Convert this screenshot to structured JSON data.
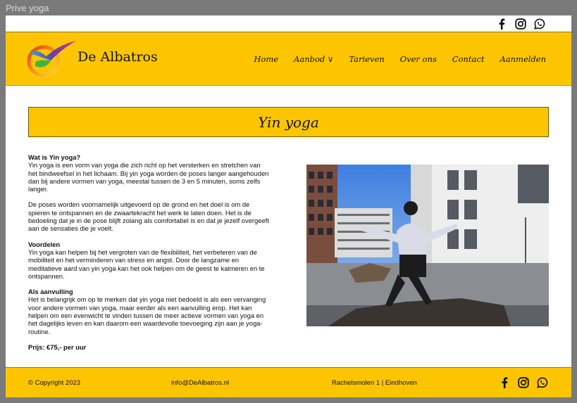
{
  "window": {
    "title": "Prive yoga"
  },
  "social": {
    "icons": [
      "facebook-icon",
      "instagram-icon",
      "whatsapp-icon"
    ]
  },
  "header": {
    "brand": "De Albatros",
    "nav": [
      "Home",
      "Aanbod ∨",
      "Tarieven",
      "Over ons",
      "Contact",
      "Aanmelden"
    ]
  },
  "main": {
    "title": "Yin yoga",
    "sections": [
      {
        "heading": "Wat is Yin yoga?",
        "body": "Yin yoga is een vorm van yoga die zich richt op het versterken en stretchen van het bindweefsel in het lichaam. Bij yin yoga worden de poses langer aangehouden dan bij andere vormen van yoga, meestal tussen de 3 en 5 minuten, soms zelfs langer."
      },
      {
        "heading": "",
        "body": "De poses worden voornamelijk uitgevoerd op de grond en het doel is om de spieren te ontspannen en de zwaartekracht het werk te laten doen. Het is de bedoeling dat je in de pose blijft zolang als comfortabel is en dat je jezelf overgeeft aan de sensaties die je voelt."
      },
      {
        "heading": "Voordelen",
        "body": "Yin yoga kan helpen bij het vergroten van de flexibiliteit, het verbeteren van de mobiliteit en het verminderen van stress en angst. Door de langzame en meditatieve aard van yin yoga kan het ook helpen om de geest te kalmeren en te ontspannen."
      },
      {
        "heading": "Als aanvulling",
        "body": "Het is belangrijk om op te merken dat yin yoga niet bedoeld is als een vervanging voor andere vormen van yoga, maar eerder als een aanvulling erop. Het kan helpen om een evenwicht te vinden tussen de meer actieve vormen van yoga en het dagelijks leven en kan daarom een waardevolle toevoeging zijn aan je yoga-routine."
      }
    ],
    "price": "Prijs: €75,- per uur"
  },
  "footer": {
    "copyright": "© Copyright 2023",
    "email": "info@DeAlbatros.nl",
    "address": "Rachelsmolen 1 | Eindhoven"
  },
  "colors": {
    "accent": "#fdc500",
    "text": "#111111",
    "background": "#ffffff"
  }
}
